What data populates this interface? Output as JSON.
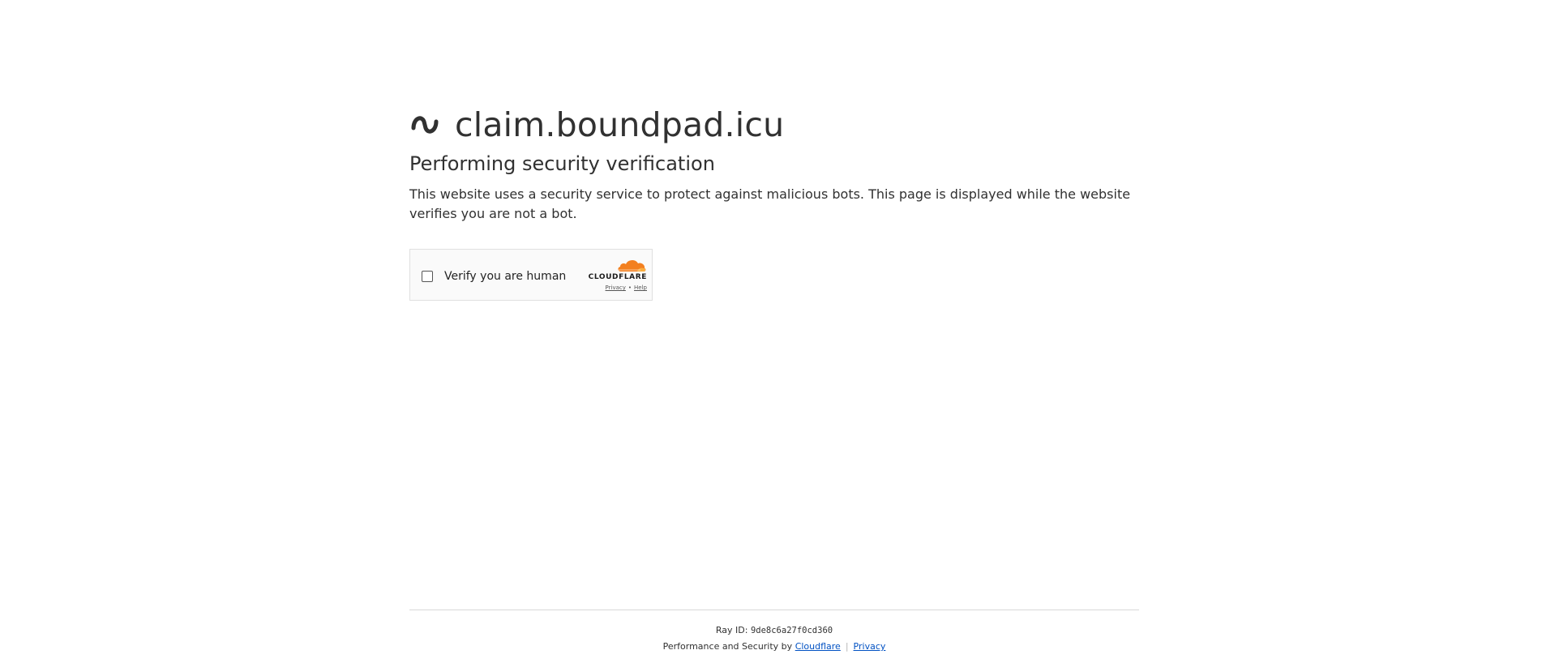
{
  "site": {
    "name": "claim.boundpad.icu",
    "logo_icon": "tilde-wave-icon"
  },
  "heading": "Performing security verification",
  "description": "This website uses a security service to protect against malicious bots. This page is displayed while the website verifies you are not a bot.",
  "widget": {
    "checkbox_label": "Verify you are human",
    "checkbox_checked": false,
    "brand": "CLOUDFLARE",
    "privacy_link": "Privacy",
    "separator": "•",
    "help_link": "Help",
    "brand_color": "#f38020"
  },
  "footer": {
    "ray_label": "Ray ID:",
    "ray_id": "9de8c6a27f0cd360",
    "perf_text": "Performance and Security by",
    "cloudflare_link": "Cloudflare",
    "privacy_link": "Privacy",
    "link_color": "#0051c3"
  }
}
